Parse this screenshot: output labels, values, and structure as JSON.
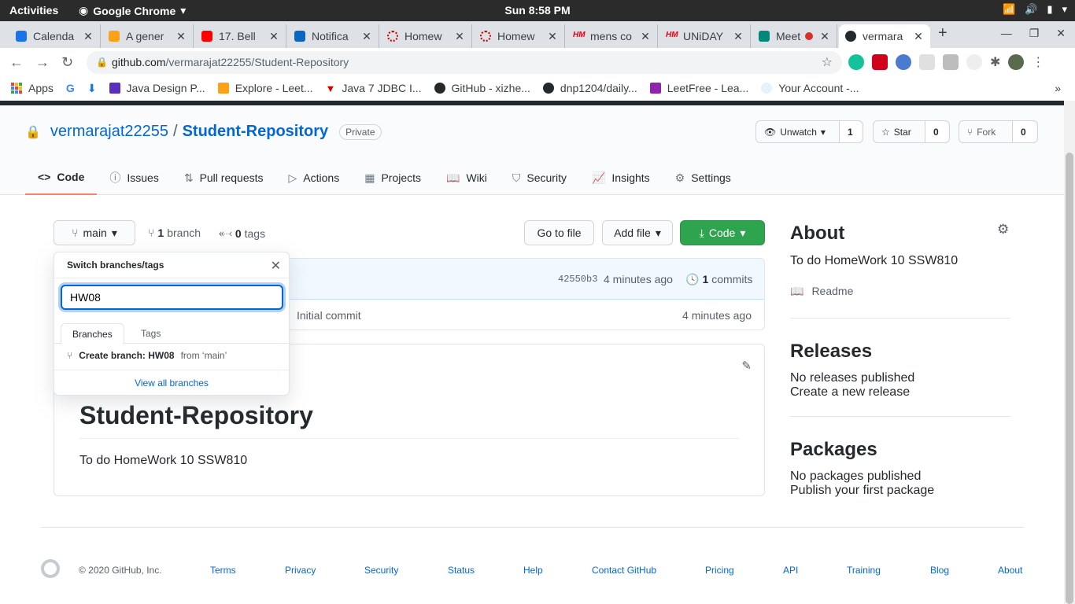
{
  "os": {
    "activities": "Activities",
    "app_name": "Google Chrome",
    "clock": "Sun  8:58 PM"
  },
  "browser": {
    "tabs": [
      {
        "title": "Calenda",
        "color": "#1a73e8"
      },
      {
        "title": "A gener",
        "color": "#ffa116"
      },
      {
        "title": "17. Bell",
        "color": "#ff0000"
      },
      {
        "title": "Notifica",
        "color": "#0a66c2"
      },
      {
        "title": "Homew",
        "color": "#cc0000"
      },
      {
        "title": "Homew",
        "color": "#cc0000"
      },
      {
        "title": "mens co",
        "color": "#e50010"
      },
      {
        "title": "UNiDAY",
        "color": "#e50010"
      },
      {
        "title": "Meet",
        "color": "#00897b"
      },
      {
        "title": "vermara",
        "color": "#24292e"
      }
    ],
    "url_host": "github.com",
    "url_path": "/vermarajat22255/Student-Repository",
    "bookmarks": [
      "Apps",
      "",
      "",
      "Java Design P...",
      "Explore - Leet...",
      "Java 7 JDBC I...",
      "GitHub - xizhe...",
      "dnp1204/daily...",
      "LeetFree - Lea...",
      "Your Account -..."
    ]
  },
  "repo": {
    "owner": "vermarajat22255",
    "separator": "/",
    "name": "Student-Repository",
    "visibility": "Private",
    "unwatch_label": "Unwatch",
    "watch_count": "1",
    "star_label": "Star",
    "star_count": "0",
    "fork_label": "Fork",
    "fork_count": "0"
  },
  "nav": [
    "Code",
    "Issues",
    "Pull requests",
    "Actions",
    "Projects",
    "Wiki",
    "Security",
    "Insights",
    "Settings"
  ],
  "toolbar": {
    "branch": "main",
    "branch_count": "1",
    "branch_word": "branch",
    "tag_count": "0",
    "tag_word": "tags",
    "go_to_file": "Go to file",
    "add_file": "Add file",
    "code": "Code"
  },
  "commit": {
    "sha": "42550b3",
    "time": "4 minutes ago",
    "count": "1",
    "count_word": "commits",
    "file_message": "Initial commit",
    "file_time": "4 minutes ago"
  },
  "readme": {
    "title": "Student-Repository",
    "body": "To do HomeWork 10 SSW810"
  },
  "about": {
    "heading": "About",
    "description": "To do HomeWork 10 SSW810",
    "readme_label": "Readme",
    "releases_heading": "Releases",
    "releases_text": "No releases published",
    "releases_link": "Create a new release",
    "packages_heading": "Packages",
    "packages_text": "No packages published",
    "packages_link": "Publish your first package"
  },
  "branch_dropdown": {
    "title": "Switch branches/tags",
    "input_value": "HW08",
    "tab_branches": "Branches",
    "tab_tags": "Tags",
    "create_label": "Create branch: HW08",
    "create_from": "from ‘main’",
    "view_all": "View all branches"
  },
  "footer": {
    "copyright": "© 2020 GitHub, Inc.",
    "links": [
      "Terms",
      "Privacy",
      "Security",
      "Status",
      "Help",
      "Contact GitHub",
      "Pricing",
      "API",
      "Training",
      "Blog",
      "About"
    ]
  }
}
